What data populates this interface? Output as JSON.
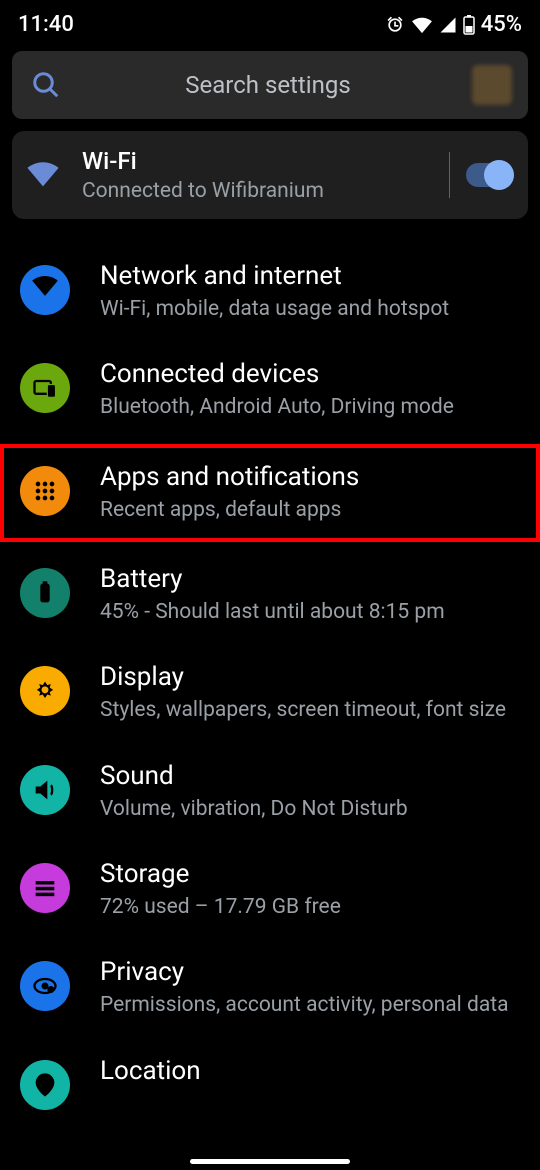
{
  "statusbar": {
    "time": "11:40",
    "battery_text": "45%"
  },
  "search": {
    "placeholder": "Search settings"
  },
  "wifi_card": {
    "title": "Wi-Fi",
    "subtitle": "Connected to Wifibranium",
    "toggle_on": true
  },
  "items": [
    {
      "id": "network",
      "title": "Network and internet",
      "subtitle": "Wi-Fi, mobile, data usage and hotspot",
      "color": "#1a73e8",
      "highlight": false
    },
    {
      "id": "devices",
      "title": "Connected devices",
      "subtitle": "Bluetooth, Android Auto, Driving mode",
      "color": "#6aa80e",
      "highlight": false
    },
    {
      "id": "apps",
      "title": "Apps and notifications",
      "subtitle": "Recent apps, default apps",
      "color": "#f28b0c",
      "highlight": true
    },
    {
      "id": "battery",
      "title": "Battery",
      "subtitle": "45% - Should last until about 8:15 pm",
      "color": "#12806a",
      "highlight": false
    },
    {
      "id": "display",
      "title": "Display",
      "subtitle": "Styles, wallpapers, screen timeout, font size",
      "color": "#f9ab00",
      "highlight": false
    },
    {
      "id": "sound",
      "title": "Sound",
      "subtitle": "Volume, vibration, Do Not Disturb",
      "color": "#12b5a5",
      "highlight": false
    },
    {
      "id": "storage",
      "title": "Storage",
      "subtitle": "72% used – 17.79 GB free",
      "color": "#c53bdc",
      "highlight": false
    },
    {
      "id": "privacy",
      "title": "Privacy",
      "subtitle": "Permissions, account activity, personal data",
      "color": "#1a73e8",
      "highlight": false
    },
    {
      "id": "location",
      "title": "Location",
      "subtitle": "",
      "color": "#12b5a5",
      "highlight": false
    }
  ]
}
